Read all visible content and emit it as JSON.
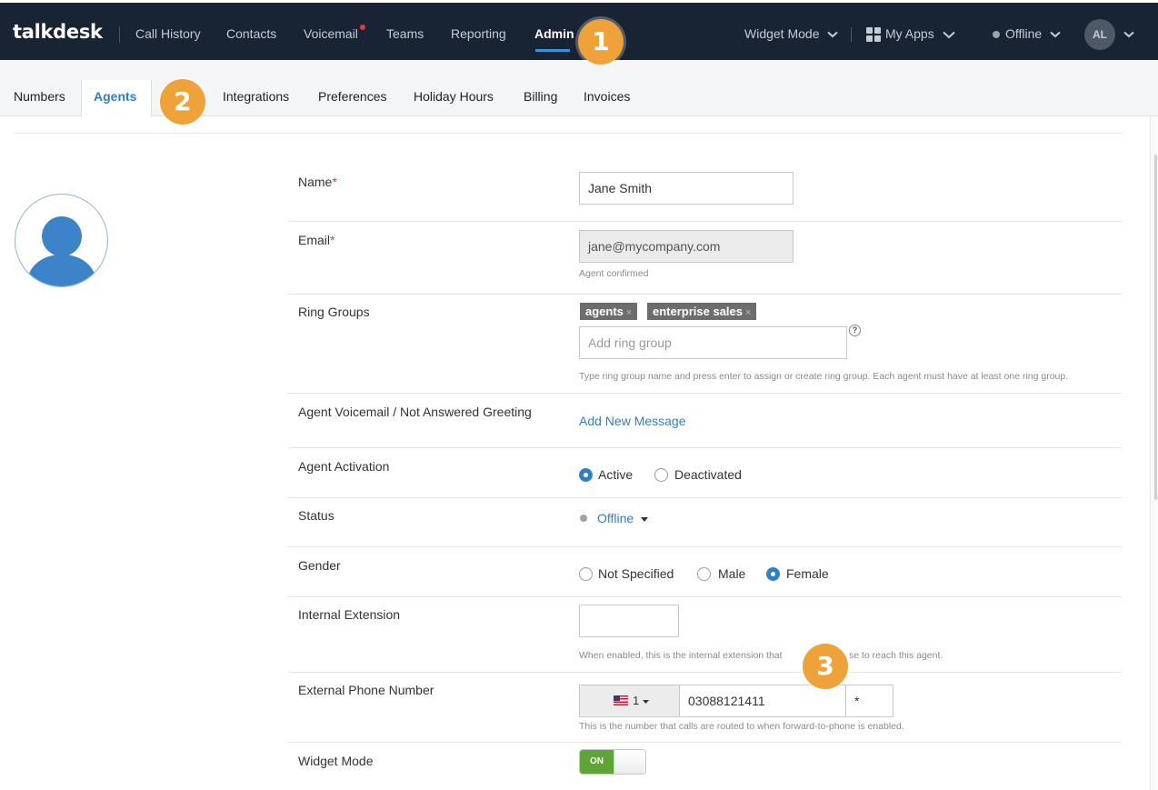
{
  "topnav": {
    "logo": "talkdesk",
    "links": [
      "Call History",
      "Contacts",
      "Voicemail",
      "Teams",
      "Reporting",
      "Admin"
    ],
    "widget_mode": "Widget Mode",
    "my_apps": "My Apps",
    "status": "Offline",
    "avatar_initials": "AL"
  },
  "steps": [
    "1",
    "2",
    "3"
  ],
  "subnav": {
    "tabs": [
      "Numbers",
      "Agents",
      "Integrations",
      "Preferences",
      "Holiday Hours",
      "Billing",
      "Invoices"
    ]
  },
  "form": {
    "name": {
      "label": "Name",
      "required": "*",
      "value": "Jane Smith"
    },
    "email": {
      "label": "Email",
      "required": "*",
      "value": "jane@mycompany.com",
      "help": "Agent confirmed"
    },
    "ring_groups": {
      "label": "Ring Groups",
      "tags": [
        "agents",
        "enterprise sales"
      ],
      "remove": "×",
      "placeholder": "Add ring group",
      "help_icon": "?",
      "help": "Type ring group name and press enter to assign or create ring group. Each agent must have at least one ring group."
    },
    "voicemail": {
      "label": "Agent Voicemail / Not Answered Greeting",
      "link": "Add New Message"
    },
    "activation": {
      "label": "Agent Activation",
      "options": [
        "Active",
        "Deactivated"
      ],
      "selected": "Active"
    },
    "status": {
      "label": "Status",
      "value": "Offline"
    },
    "gender": {
      "label": "Gender",
      "options": [
        "Not Specified",
        "Male",
        "Female"
      ],
      "selected": "Female"
    },
    "internal_extension": {
      "label": "Internal Extension",
      "value": "",
      "help_left": "When enabled, this is the internal extension that",
      "help_right": "se to reach this agent."
    },
    "external_phone": {
      "label": "External Phone Number",
      "country_code": "1",
      "number": "03088121411",
      "extension": "*",
      "help": "This is the number that calls are routed to when forward-to-phone is enabled."
    },
    "widget_mode": {
      "label": "Widget Mode",
      "toggle": "ON"
    }
  },
  "colors": {
    "nav_bg": "#182433",
    "accent": "#2f80c9",
    "step_badge": "#f0a23a",
    "toggle_on": "#5ea437"
  }
}
